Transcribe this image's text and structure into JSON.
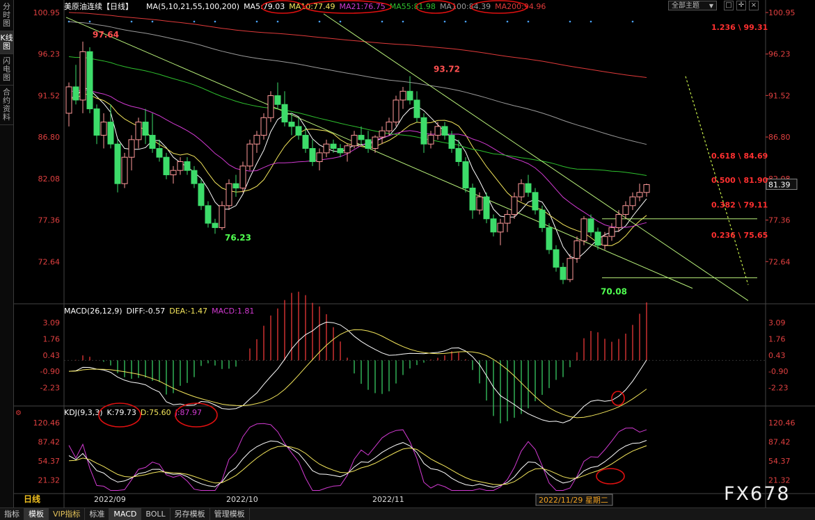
{
  "sidebar": {
    "tabs": [
      {
        "label": "分时图",
        "active": false
      },
      {
        "label": "K线图",
        "active": true
      },
      {
        "label": "闪电图",
        "active": false
      },
      {
        "label": "合约资料",
        "active": false
      }
    ]
  },
  "toolbar": {
    "theme_select": "全部主题",
    "icons": [
      "window-icon",
      "crosshair-icon",
      "close-icon"
    ]
  },
  "header": {
    "title": "美原油连续【日线】",
    "ma_legend": [
      {
        "text": "MA(5,10,21,55,100,200)",
        "color": "#ffffff"
      },
      {
        "text": "MA5:79.03",
        "color": "#ffffff"
      },
      {
        "text": "MA10:77.49",
        "color": "#f5e75c"
      },
      {
        "text": "MA21:76.75",
        "color": "#d23ad2"
      },
      {
        "text": "MA55:81.98",
        "color": "#2ec02e"
      },
      {
        "text": "MA100:84.39",
        "color": "#9a9a9a"
      },
      {
        "text": "MA200:94.96",
        "color": "#e03a3a"
      }
    ]
  },
  "macd_header": [
    {
      "text": "MACD(26,12,9)",
      "color": "#ffffff"
    },
    {
      "text": "DIFF:-0.57",
      "color": "#ffffff"
    },
    {
      "text": "DEA:-1.47",
      "color": "#f5e75c"
    },
    {
      "text": "MACD:1.81",
      "color": "#d23ad2"
    }
  ],
  "kdj_header": [
    {
      "text": "KDJ(9,3,3)",
      "color": "#ffffff"
    },
    {
      "text": "K:79.73",
      "color": "#ffffff"
    },
    {
      "text": "D:75.60",
      "color": "#f5e75c"
    },
    {
      "text": "J:87.97",
      "color": "#d23ad2"
    }
  ],
  "chart_data": {
    "type": "candlestick",
    "price_axis": {
      "ylim": [
        68.0,
        100.95
      ],
      "ticks": [
        "100.95",
        "96.23",
        "91.52",
        "86.80",
        "82.08",
        "77.36",
        "72.64"
      ]
    },
    "x_labels": [
      {
        "label": "2022/09",
        "index": 5
      },
      {
        "label": "2022/10",
        "index": 24
      },
      {
        "label": "2022/11",
        "index": 45
      }
    ],
    "cursor_label": "2022/11/29 星期二",
    "current_price": "81.39",
    "annotations": [
      {
        "label": "97.64",
        "index": 3,
        "value": 97.64,
        "color": "#ff5050"
      },
      {
        "label": "76.23",
        "index": 22,
        "value": 76.23,
        "color": "#50ff50"
      },
      {
        "label": "93.72",
        "index": 52,
        "value": 93.72,
        "color": "#ff5050"
      },
      {
        "label": "70.08",
        "index": 76,
        "value": 70.08,
        "color": "#50ff50"
      }
    ],
    "fib_levels": [
      {
        "label": "1.236 \\ 99.31",
        "value": 99.31
      },
      {
        "label": "0.618 \\ 84.69",
        "value": 84.69
      },
      {
        "label": "0.500 \\ 81.90",
        "value": 81.9
      },
      {
        "label": "0.382 \\ 79.11",
        "value": 79.11
      },
      {
        "label": "0.236 \\ 75.65",
        "value": 75.65
      }
    ],
    "horizontal_lines": [
      77.5,
      70.8
    ],
    "trendlines": [
      {
        "from": [
          0,
          100.4
        ],
        "to": [
          90,
          69.6
        ]
      },
      {
        "from": [
          37,
          100.8
        ],
        "to": [
          98,
          68.2
        ]
      }
    ],
    "dotted_projection": {
      "from": [
        89,
        93.7
      ],
      "to": [
        98,
        70.0
      ]
    },
    "candles": [
      [
        89.5,
        93.0,
        88.0,
        92.5
      ],
      [
        92.5,
        95.0,
        90.5,
        91.0
      ],
      [
        91.0,
        97.64,
        89.5,
        96.5
      ],
      [
        96.5,
        97.0,
        89.5,
        90.0
      ],
      [
        90.0,
        90.5,
        86.0,
        87.0
      ],
      [
        87.0,
        89.5,
        85.5,
        88.5
      ],
      [
        88.5,
        90.5,
        85.5,
        86.0
      ],
      [
        86.0,
        86.5,
        80.5,
        81.5
      ],
      [
        81.5,
        85.0,
        81.0,
        84.5
      ],
      [
        84.5,
        87.0,
        83.0,
        86.5
      ],
      [
        86.5,
        89.0,
        85.5,
        88.5
      ],
      [
        88.5,
        90.0,
        86.0,
        87.0
      ],
      [
        87.0,
        89.5,
        85.0,
        85.5
      ],
      [
        85.5,
        86.5,
        84.0,
        84.5
      ],
      [
        84.5,
        85.0,
        82.0,
        82.5
      ],
      [
        82.5,
        83.5,
        81.5,
        83.0
      ],
      [
        83.0,
        84.5,
        82.5,
        84.0
      ],
      [
        84.0,
        84.5,
        82.5,
        83.0
      ],
      [
        83.0,
        83.5,
        81.0,
        81.5
      ],
      [
        81.5,
        82.0,
        78.5,
        79.0
      ],
      [
        79.0,
        79.5,
        76.5,
        77.0
      ],
      [
        77.0,
        77.5,
        75.8,
        76.5
      ],
      [
        76.5,
        79.5,
        76.23,
        79.0
      ],
      [
        79.0,
        82.0,
        78.5,
        81.5
      ],
      [
        81.5,
        82.5,
        80.0,
        81.0
      ],
      [
        81.0,
        84.0,
        80.5,
        83.5
      ],
      [
        83.5,
        86.5,
        83.0,
        86.0
      ],
      [
        86.0,
        87.5,
        85.0,
        87.0
      ],
      [
        87.0,
        89.5,
        86.5,
        89.0
      ],
      [
        89.0,
        92.0,
        88.5,
        91.5
      ],
      [
        91.5,
        93.0,
        90.0,
        90.5
      ],
      [
        90.5,
        92.0,
        88.0,
        88.5
      ],
      [
        88.5,
        89.5,
        87.0,
        88.0
      ],
      [
        88.0,
        89.0,
        86.5,
        87.0
      ],
      [
        87.0,
        88.0,
        85.0,
        85.5
      ],
      [
        85.5,
        86.5,
        83.5,
        84.0
      ],
      [
        84.0,
        85.5,
        83.0,
        85.0
      ],
      [
        85.0,
        86.5,
        84.5,
        86.0
      ],
      [
        86.0,
        86.5,
        85.0,
        85.5
      ],
      [
        85.5,
        86.0,
        84.5,
        85.0
      ],
      [
        85.0,
        86.0,
        84.0,
        85.8
      ],
      [
        85.8,
        87.5,
        85.5,
        87.0
      ],
      [
        87.0,
        88.0,
        86.0,
        86.5
      ],
      [
        86.5,
        87.5,
        85.0,
        85.5
      ],
      [
        85.5,
        87.0,
        85.0,
        86.8
      ],
      [
        86.8,
        88.0,
        86.0,
        87.5
      ],
      [
        87.5,
        89.0,
        87.0,
        88.5
      ],
      [
        88.5,
        91.5,
        88.0,
        91.0
      ],
      [
        91.0,
        92.5,
        90.0,
        92.0
      ],
      [
        92.0,
        93.72,
        90.5,
        91.0
      ],
      [
        91.0,
        92.0,
        88.5,
        89.0
      ],
      [
        89.0,
        89.5,
        85.0,
        86.0
      ],
      [
        86.0,
        87.5,
        85.5,
        87.0
      ],
      [
        87.0,
        88.5,
        86.5,
        88.0
      ],
      [
        88.0,
        88.5,
        86.5,
        87.0
      ],
      [
        87.0,
        87.5,
        85.0,
        85.5
      ],
      [
        85.5,
        86.5,
        83.5,
        84.0
      ],
      [
        84.0,
        84.5,
        80.5,
        81.0
      ],
      [
        81.0,
        81.5,
        77.5,
        78.5
      ],
      [
        78.5,
        80.5,
        78.0,
        80.0
      ],
      [
        80.0,
        80.5,
        77.0,
        77.5
      ],
      [
        77.5,
        78.0,
        75.5,
        76.0
      ],
      [
        76.0,
        77.5,
        74.5,
        77.0
      ],
      [
        77.0,
        78.5,
        76.0,
        78.0
      ],
      [
        78.0,
        80.5,
        77.5,
        80.0
      ],
      [
        80.0,
        82.0,
        79.5,
        81.5
      ],
      [
        81.5,
        82.5,
        80.0,
        80.5
      ],
      [
        80.5,
        81.0,
        78.0,
        78.5
      ],
      [
        78.5,
        79.0,
        76.0,
        76.5
      ],
      [
        76.5,
        77.0,
        73.5,
        74.0
      ],
      [
        74.0,
        74.5,
        71.5,
        72.0
      ],
      [
        72.0,
        72.5,
        70.08,
        70.6
      ],
      [
        70.6,
        73.5,
        70.3,
        73.0
      ],
      [
        73.0,
        75.5,
        72.5,
        75.0
      ],
      [
        75.0,
        77.8,
        74.5,
        77.5
      ],
      [
        77.5,
        78.0,
        75.5,
        76.0
      ],
      [
        76.0,
        76.5,
        74.0,
        74.5
      ],
      [
        74.5,
        76.0,
        74.0,
        75.5
      ],
      [
        75.5,
        77.0,
        75.0,
        76.5
      ],
      [
        76.5,
        78.5,
        76.0,
        78.0
      ],
      [
        78.0,
        79.5,
        77.5,
        79.0
      ],
      [
        79.0,
        80.5,
        78.5,
        80.0
      ],
      [
        80.0,
        81.5,
        79.5,
        80.5
      ],
      [
        80.5,
        81.5,
        80.0,
        81.39
      ]
    ],
    "macd_axis": {
      "ylim": [
        -3.5,
        3.6
      ],
      "ticks": [
        "3.09",
        "1.76",
        "0.43",
        "-0.90",
        "-2.23"
      ]
    },
    "kdj_axis": {
      "ylim": [
        0,
        130
      ],
      "ticks": [
        "120.46",
        "87.42",
        "54.37",
        "21.32"
      ]
    },
    "timeframe_label": "日线"
  },
  "bottom_tabs": [
    {
      "label": "指标",
      "active": false,
      "vip": false
    },
    {
      "label": "模板",
      "active": true,
      "vip": false
    },
    {
      "label": "VIP指标",
      "active": false,
      "vip": true
    },
    {
      "label": "标准",
      "active": false,
      "vip": false
    },
    {
      "label": "MACD",
      "active": true,
      "vip": false
    },
    {
      "label": "BOLL",
      "active": false,
      "vip": false
    },
    {
      "label": "另存模板",
      "active": false,
      "vip": false
    },
    {
      "label": "管理模板",
      "active": false,
      "vip": false
    }
  ],
  "watermark": "FX678"
}
